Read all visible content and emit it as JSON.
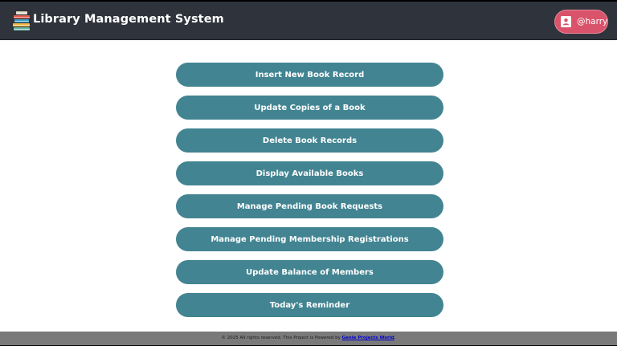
{
  "header": {
    "title": "Library Management System",
    "logo_icon": "stacked-books-icon",
    "user": {
      "icon": "contact-card-icon",
      "label": "@harry"
    }
  },
  "menu": {
    "items": [
      {
        "label": "Insert New Book Record"
      },
      {
        "label": "Update Copies of a Book"
      },
      {
        "label": "Delete Book Records"
      },
      {
        "label": "Display Available Books"
      },
      {
        "label": "Manage Pending Book Requests"
      },
      {
        "label": "Manage Pending Membership Registrations"
      },
      {
        "label": "Update Balance of Members"
      },
      {
        "label": "Today's Reminder"
      }
    ]
  },
  "footer": {
    "text": "© 2025 All rights reserved. This Project is Powered by ",
    "link_text": "Genie Projects World",
    "suffix": "."
  },
  "colors": {
    "header_bg": "#2f333b",
    "button_bg": "#428492",
    "user_button_bg": "#d9536a",
    "footer_bg": "#7a7a7a"
  }
}
